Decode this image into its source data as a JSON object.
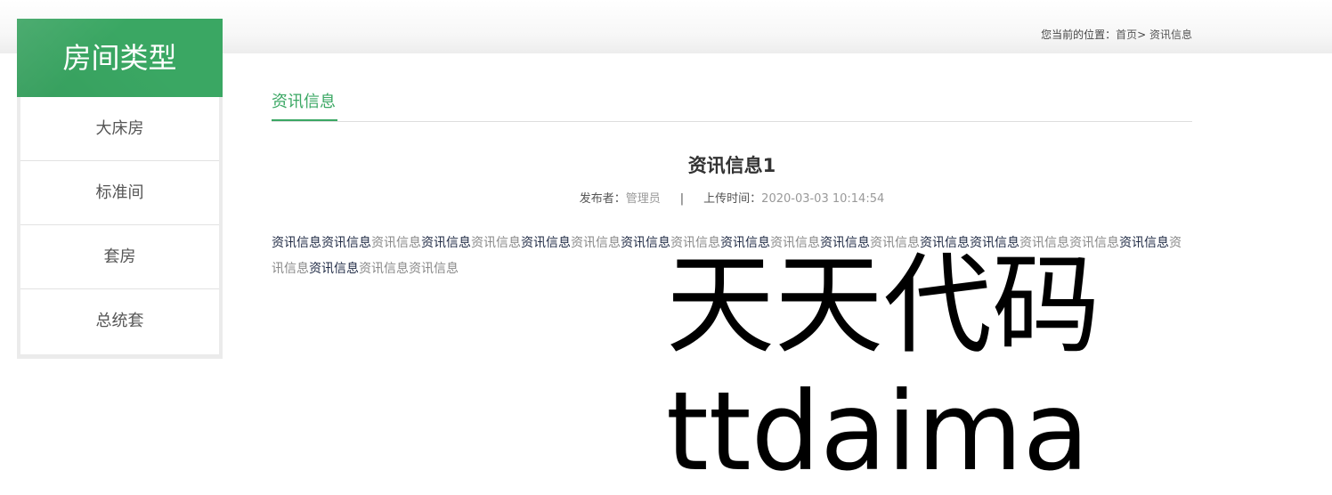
{
  "breadcrumb": {
    "prefix": "您当前的位置：",
    "home": "首页",
    "arrow": ">",
    "current": "资讯信息"
  },
  "sidebar": {
    "title": "房间类型",
    "items": [
      {
        "label": "大床房"
      },
      {
        "label": "标准间"
      },
      {
        "label": "套房"
      },
      {
        "label": "总统套"
      }
    ]
  },
  "section": {
    "title": "资讯信息"
  },
  "article": {
    "title": "资讯信息1",
    "publisher_label": "发布者：",
    "publisher": "管理员",
    "separator": "|",
    "upload_label": "上传时间：",
    "upload_time": "2020-03-03 10:14:54",
    "body_segment": "资讯信息",
    "body_repeat": 22
  },
  "watermark": {
    "line1": "天天代码",
    "line2": "ttdaima"
  }
}
